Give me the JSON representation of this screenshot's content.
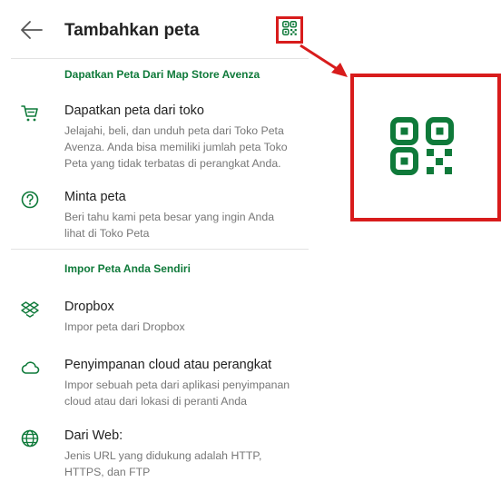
{
  "header": {
    "title": "Tambahkan peta",
    "back_icon": "arrow-left-icon",
    "qr_icon": "qr-code-icon"
  },
  "sections": [
    {
      "title": "Dapatkan Peta Dari Map Store Avenza"
    },
    {
      "title": "Impor Peta Anda Sendiri"
    }
  ],
  "items": [
    {
      "icon": "shopping-cart-icon",
      "title": "Dapatkan peta dari toko",
      "desc": "Jelajahi, beli, dan unduh peta dari Toko Peta Avenza. Anda bisa memiliki jumlah peta Toko Peta yang tidak terbatas di perangkat Anda."
    },
    {
      "icon": "question-circle-icon",
      "title": "Minta peta",
      "desc": "Beri tahu kami peta besar yang ingin Anda lihat di Toko Peta"
    },
    {
      "icon": "dropbox-icon",
      "title": "Dropbox",
      "desc": "Impor peta dari Dropbox"
    },
    {
      "icon": "cloud-icon",
      "title": "Penyimpanan cloud atau perangkat",
      "desc": "Impor sebuah peta dari aplikasi penyimpanan cloud atau dari lokasi di peranti Anda"
    },
    {
      "icon": "globe-icon",
      "title": "Dari Web:",
      "desc": "Jenis URL yang didukung adalah HTTP, HTTPS, dan FTP"
    }
  ],
  "colors": {
    "accent": "#0f7a3a",
    "highlight": "#d81c1c"
  }
}
